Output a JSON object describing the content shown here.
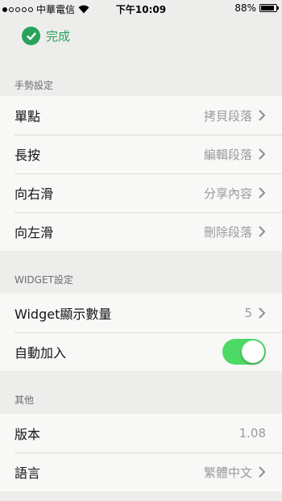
{
  "status_bar": {
    "carrier": "中華電信",
    "time": "下午10:09",
    "battery": "88%",
    "battery_level": 0.88,
    "signal_bars": 1
  },
  "nav": {
    "done_label": "完成",
    "accent_color": "#27a35a"
  },
  "sections": [
    {
      "title": "手勢設定",
      "rows": [
        {
          "label": "單點",
          "value": "拷貝段落"
        },
        {
          "label": "長按",
          "value": "編輯段落"
        },
        {
          "label": "向右滑",
          "value": "分享內容"
        },
        {
          "label": "向左滑",
          "value": "刪除段落"
        }
      ]
    },
    {
      "title": "WIDGET設定",
      "rows": [
        {
          "label": "Widget顯示數量",
          "value": "5"
        },
        {
          "label": "自動加入",
          "toggle_on": true
        }
      ]
    },
    {
      "title": "其他",
      "rows": [
        {
          "label": "版本",
          "value": "1.08"
        },
        {
          "label": "語言",
          "value": "繁體中文"
        }
      ]
    }
  ],
  "toggle_color": "#4cd964"
}
